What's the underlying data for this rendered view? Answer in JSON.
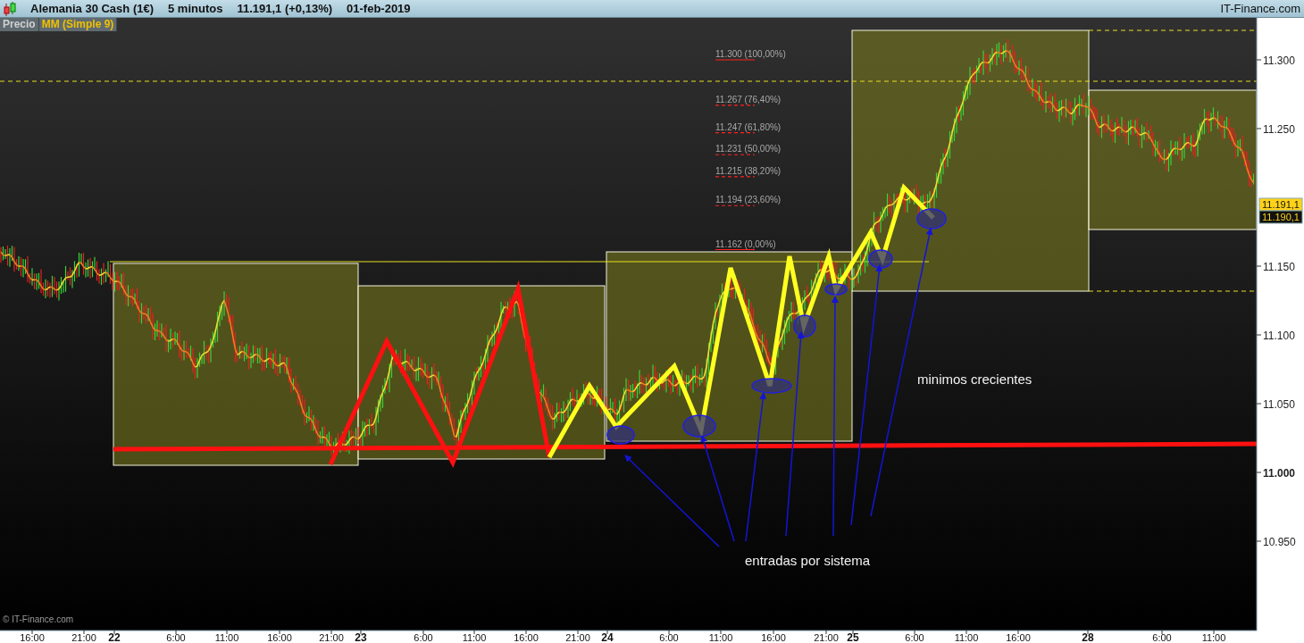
{
  "window": {
    "title_parts": [
      "Alemania 30 Cash (1€)",
      "5 minutos",
      "11.191,1 (+0,13%)",
      "01-feb-2019"
    ],
    "brand": "IT-Finance.com"
  },
  "legend": [
    {
      "label": "Precio",
      "kind": "price"
    },
    {
      "label": "MM (Simple 9)",
      "kind": "indicator"
    }
  ],
  "fib_levels": [
    {
      "price": "11.300",
      "percent": "(100,00%)",
      "kind": "solid"
    },
    {
      "price": "11.267",
      "percent": "(76,40%)",
      "kind": "dashed"
    },
    {
      "price": "11.247",
      "percent": "(61,80%)",
      "kind": "dashed"
    },
    {
      "price": "11.231",
      "percent": "(50,00%)",
      "kind": "dashed"
    },
    {
      "price": "11.215",
      "percent": "(38,20%)",
      "kind": "dashed"
    },
    {
      "price": "11.194",
      "percent": "(23,60%)",
      "kind": "dashed"
    },
    {
      "price": "11.162",
      "percent": "(0,00%)",
      "kind": "solid"
    }
  ],
  "annotations": [
    {
      "text": "minimos crecientes"
    },
    {
      "text": "entradas por sistema"
    }
  ],
  "copyright": "© IT-Finance.com",
  "price_axis": [
    {
      "label": "11.300",
      "kind": "normal"
    },
    {
      "label": "11.250",
      "kind": "normal"
    },
    {
      "label": "11.150",
      "kind": "normal"
    },
    {
      "label": "11.100",
      "kind": "normal"
    },
    {
      "label": "11.050",
      "kind": "normal"
    },
    {
      "label": "11.000",
      "kind": "major"
    },
    {
      "label": "10.950",
      "kind": "normal"
    }
  ],
  "price_badges": [
    {
      "label": "11.191,1",
      "kind": "last"
    },
    {
      "label": "11.190,1",
      "kind": "bid"
    }
  ],
  "time_axis": [
    {
      "label": "16:00",
      "kind": "time"
    },
    {
      "label": "21:00",
      "kind": "time"
    },
    {
      "label": "22",
      "kind": "day"
    },
    {
      "label": "6:00",
      "kind": "time"
    },
    {
      "label": "11:00",
      "kind": "time"
    },
    {
      "label": "16:00",
      "kind": "time"
    },
    {
      "label": "21:00",
      "kind": "time"
    },
    {
      "label": "23",
      "kind": "day"
    },
    {
      "label": "6:00",
      "kind": "time"
    },
    {
      "label": "11:00",
      "kind": "time"
    },
    {
      "label": "16:00",
      "kind": "time"
    },
    {
      "label": "21:00",
      "kind": "time"
    },
    {
      "label": "24",
      "kind": "day"
    },
    {
      "label": "6:00",
      "kind": "time"
    },
    {
      "label": "11:00",
      "kind": "time"
    },
    {
      "label": "16:00",
      "kind": "time"
    },
    {
      "label": "21:00",
      "kind": "time"
    },
    {
      "label": "25",
      "kind": "day"
    },
    {
      "label": "6:00",
      "kind": "time"
    },
    {
      "label": "11:00",
      "kind": "time"
    },
    {
      "label": "16:00",
      "kind": "time"
    },
    {
      "label": "28",
      "kind": "day"
    },
    {
      "label": "6:00",
      "kind": "time"
    },
    {
      "label": "11:00",
      "kind": "time"
    }
  ]
}
